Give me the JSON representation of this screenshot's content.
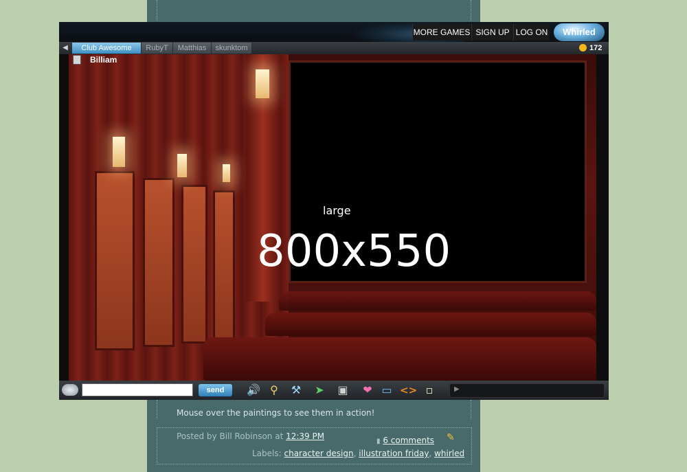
{
  "topnav": {
    "more_games": "MORE GAMES",
    "sign_up": "SIGN UP",
    "log_on": "LOG ON",
    "logo": "Whirled"
  },
  "tabs": [
    {
      "label": "Club Awesome",
      "active": true
    },
    {
      "label": "RubyT",
      "active": false
    },
    {
      "label": "Matthias",
      "active": false
    },
    {
      "label": "skunktom",
      "active": false
    }
  ],
  "coins": "172",
  "room": {
    "player_name": "Billiam",
    "screen_text_small": "large",
    "screen_text_large": "800x550"
  },
  "chat": {
    "input_value": "",
    "send_label": "send"
  },
  "toolbar_icons": [
    "volume-icon",
    "zoom-icon",
    "tools-icon",
    "cursor-icon",
    "camera-icon",
    "heart-icon",
    "chat-bubble-icon",
    "code-icon",
    "notes-icon"
  ],
  "post": {
    "body": "Mouse over the paintings to see them in action!",
    "posted_prefix": "Posted by Bill Robinson at",
    "time": "12:39 PM",
    "comments": "6 comments",
    "labels_prefix": "Labels:",
    "labels": [
      "character design",
      "illustration friday",
      "whirled"
    ]
  },
  "colors": {
    "page_bg": "#bcd0b0",
    "blog_column": "#486a6a",
    "active_tab": "#5aa6d8",
    "coin": "#f3b81a"
  }
}
